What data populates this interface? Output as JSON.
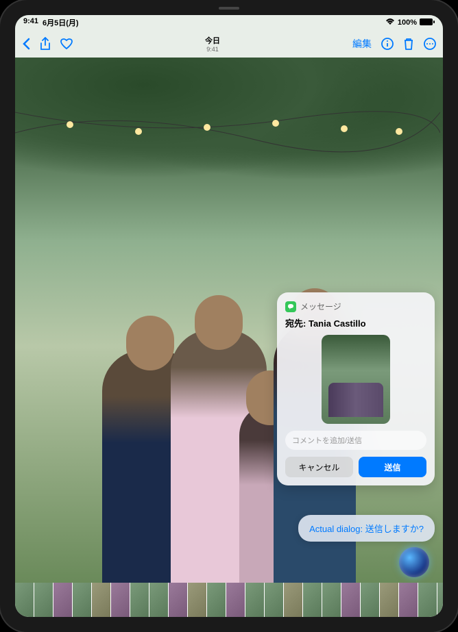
{
  "status": {
    "time": "9:41",
    "date": "6月5日(月)",
    "battery": "100%"
  },
  "toolbar": {
    "title": "今日",
    "subtitle": "9:41",
    "edit_label": "編集"
  },
  "popup": {
    "app_name": "メッセージ",
    "recipient_label": "宛先:",
    "recipient_name": "Tania Castillo",
    "input_placeholder": "コメントを追加/送信",
    "cancel_label": "キャンセル",
    "send_label": "送信"
  },
  "siri": {
    "response_prefix": "Actual dialog:",
    "response_text": "送信しますか?"
  }
}
